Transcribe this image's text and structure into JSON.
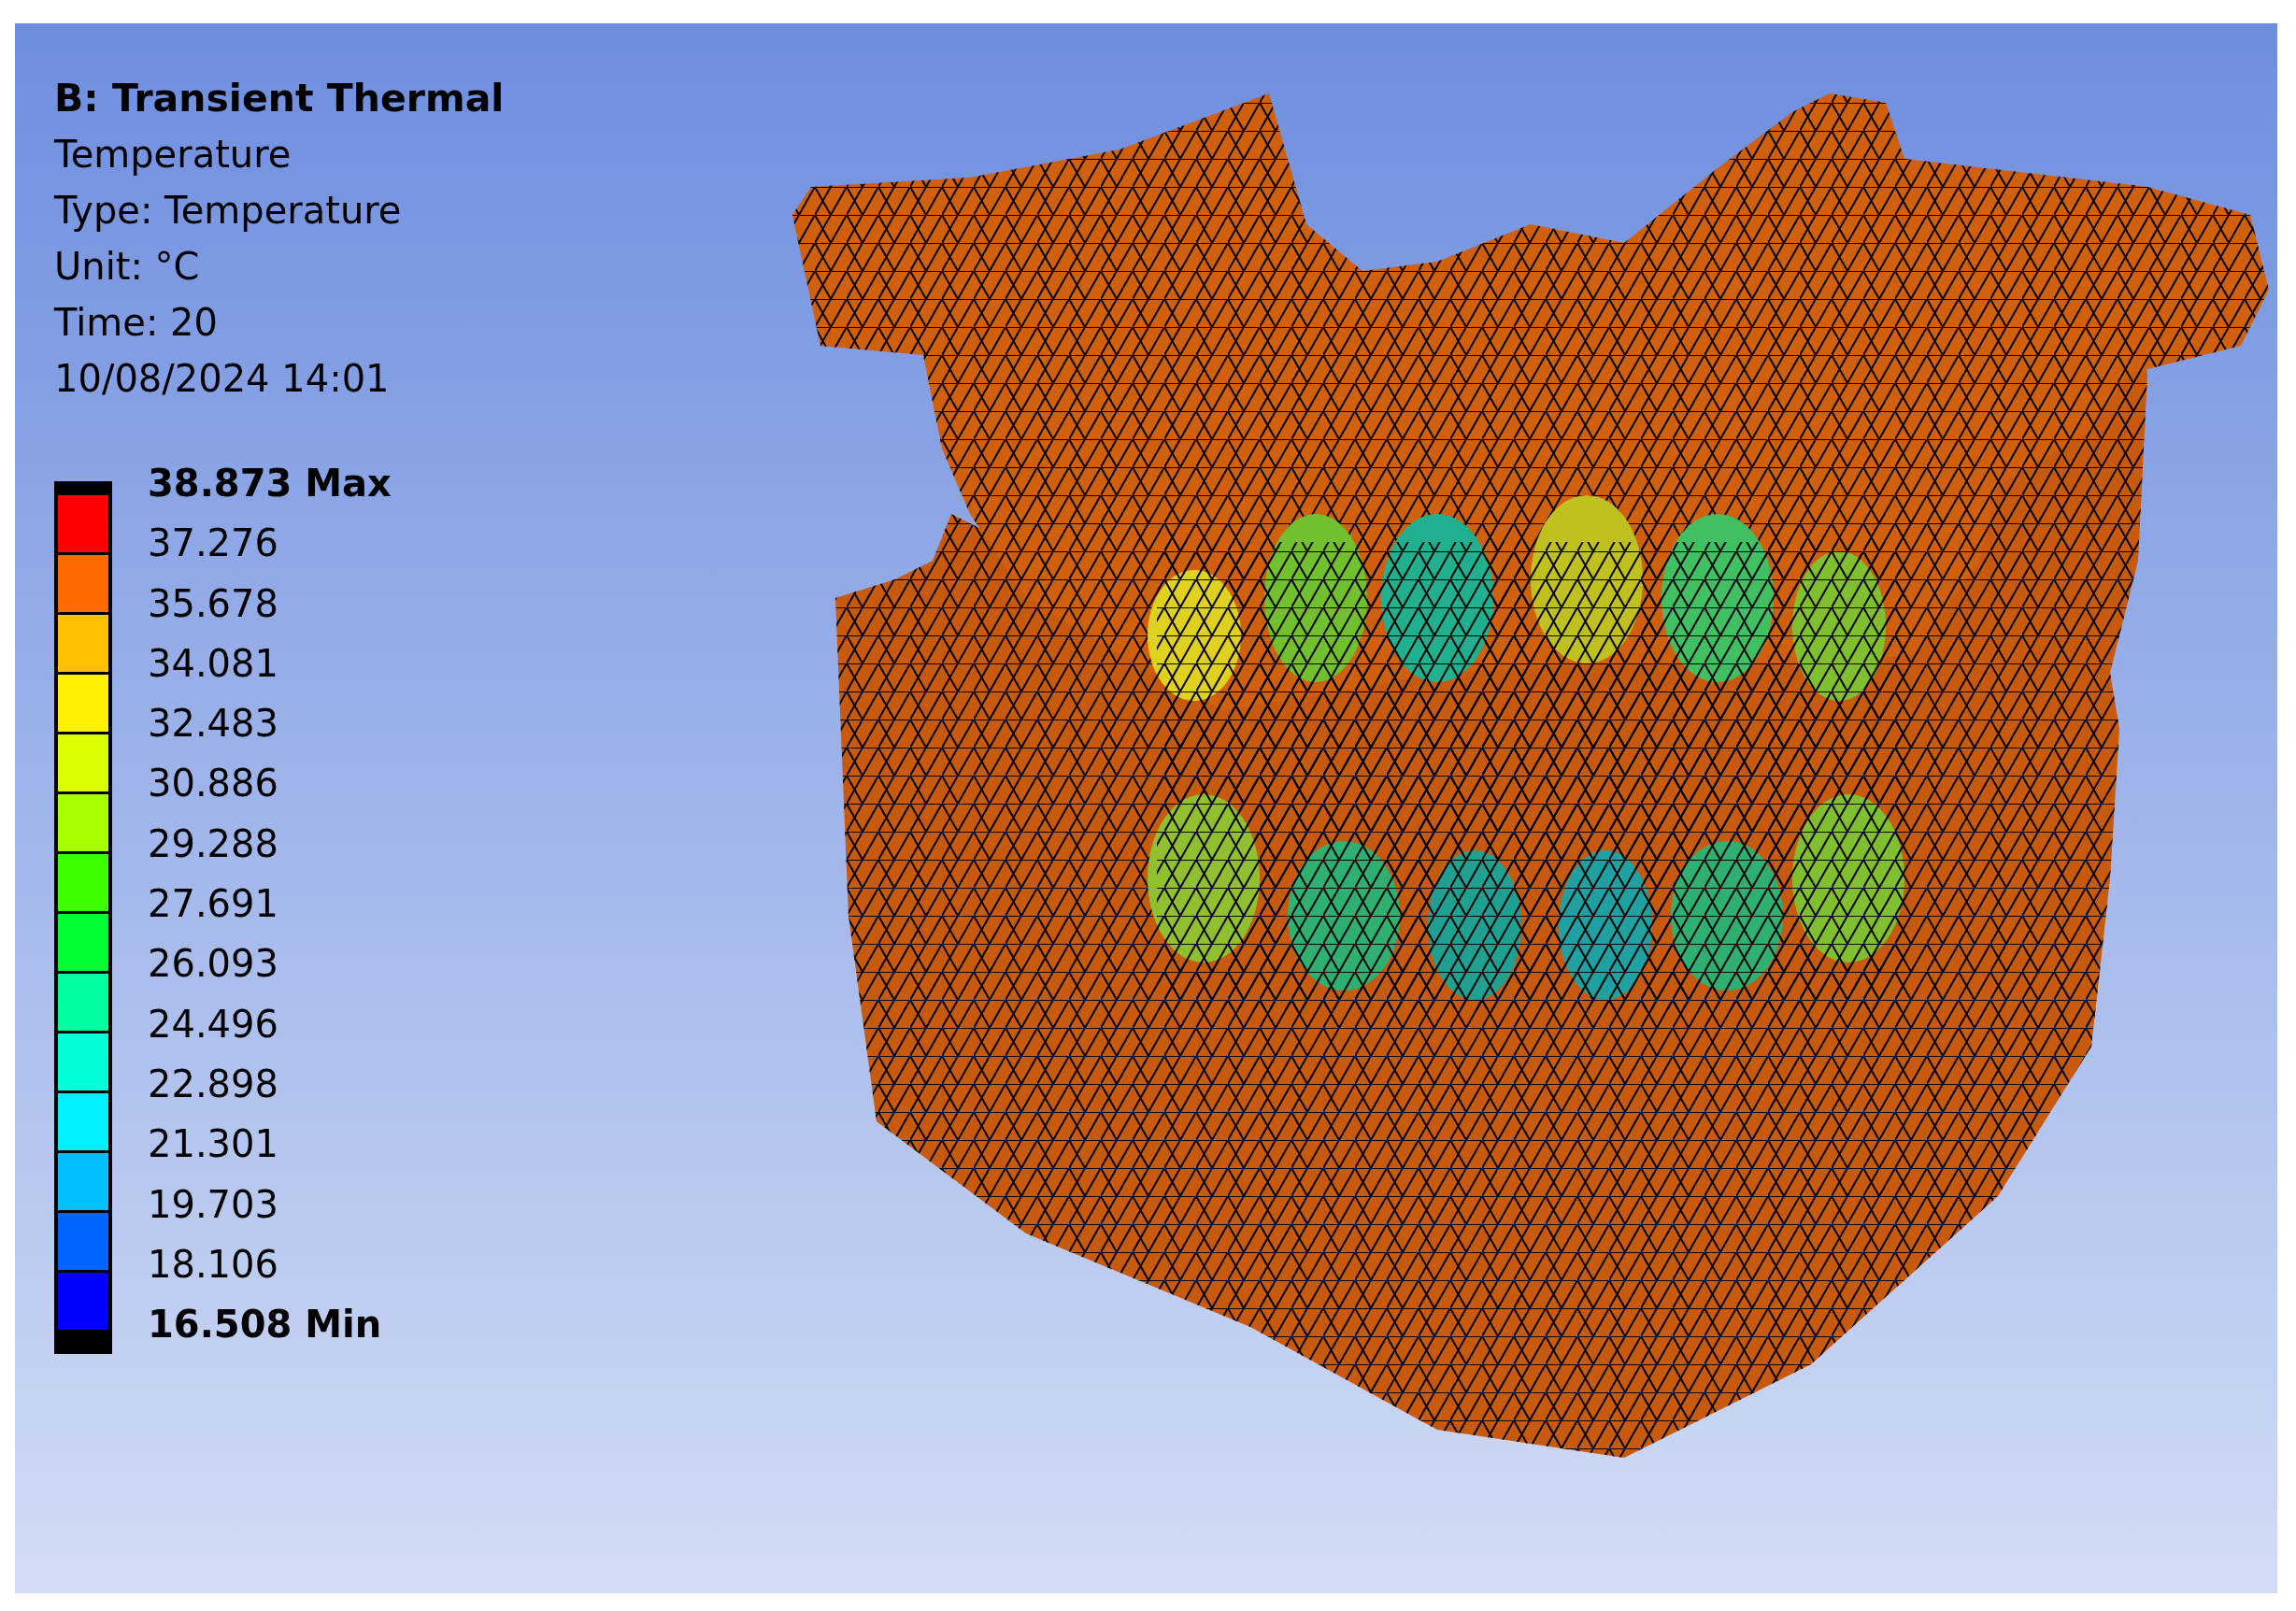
{
  "header": {
    "title": "B: Transient Thermal",
    "lines": [
      "Temperature",
      "Type: Temperature",
      "Unit: °C",
      "Time: 20",
      "10/08/2024 14:01"
    ]
  },
  "legend": {
    "max_label": "38.873 Max",
    "labels": [
      "37.276",
      "35.678",
      "34.081",
      "32.483",
      "30.886",
      "29.288",
      "27.691",
      "26.093",
      "24.496",
      "22.898",
      "21.301",
      "19.703",
      "18.106"
    ],
    "min_label": "16.508 Min",
    "bands": [
      {
        "color": "#ff0000"
      },
      {
        "color": "#ff6a00"
      },
      {
        "color": "#ffc000"
      },
      {
        "color": "#fff000"
      },
      {
        "color": "#dcff00"
      },
      {
        "color": "#a8ff00"
      },
      {
        "color": "#3cff00"
      },
      {
        "color": "#00ff32"
      },
      {
        "color": "#00ffa0"
      },
      {
        "color": "#00ffd8"
      },
      {
        "color": "#00f0ff"
      },
      {
        "color": "#00c0ff"
      },
      {
        "color": "#0064ff"
      },
      {
        "color": "#0000ff"
      }
    ]
  }
}
